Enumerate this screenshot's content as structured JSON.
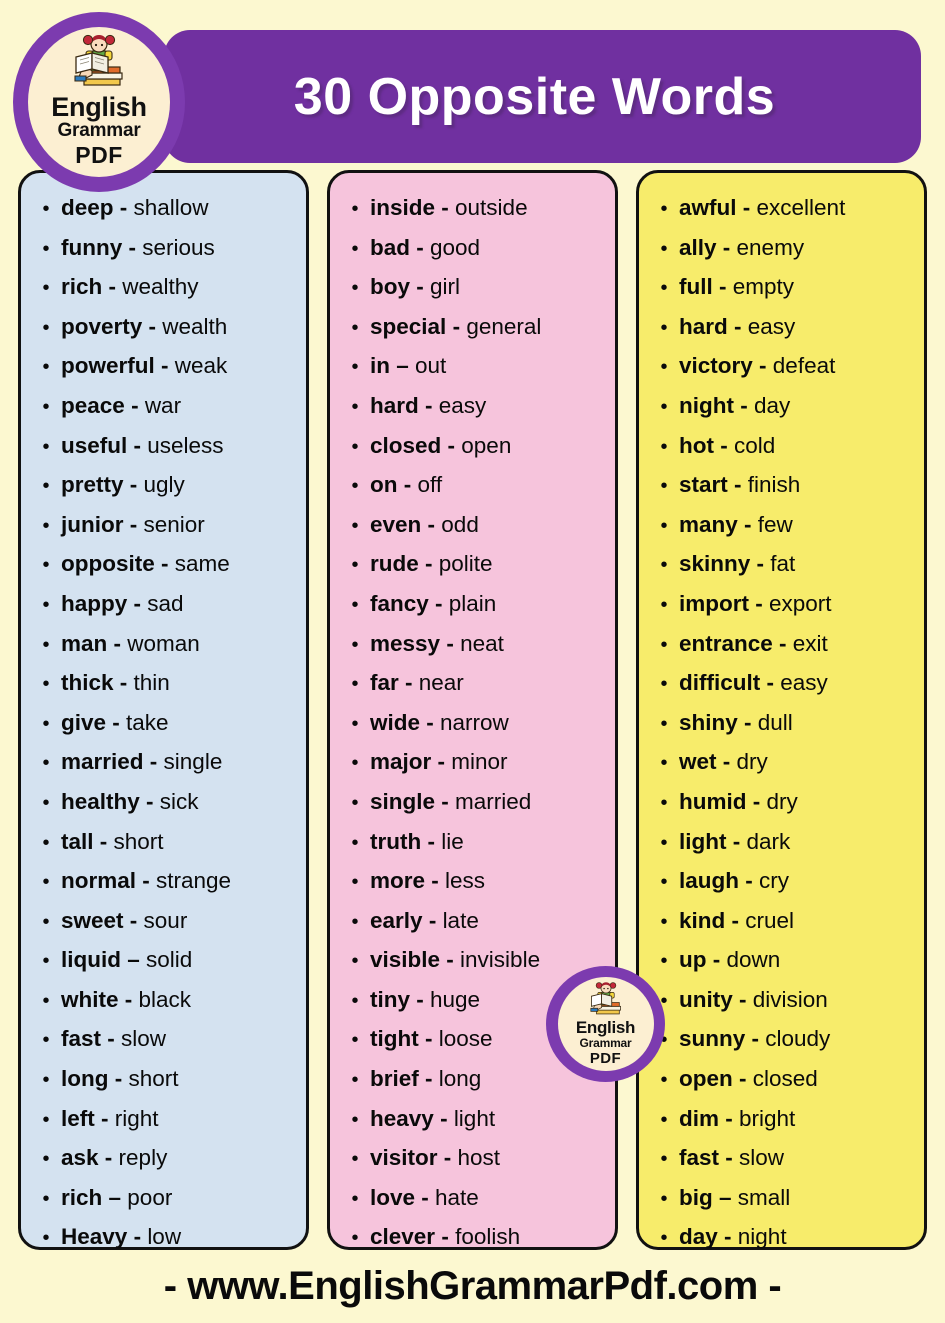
{
  "header": {
    "title": "30 Opposite Words",
    "bar_color": "#7030A0",
    "title_color": "#FFFFFF"
  },
  "logo": {
    "line1": "English",
    "line2": "Grammar",
    "line3": "PDF",
    "ring_color": "#7C3BAF",
    "face_color": "#FCEFD2",
    "icon": "girl-reading-book-on-books"
  },
  "page": {
    "background_color": "#FCF8D0"
  },
  "columns": [
    {
      "id": "column-1",
      "background_color": "#D4E2F0",
      "items": [
        {
          "word": "deep",
          "sep": "-",
          "opposite": "shallow"
        },
        {
          "word": "funny",
          "sep": "-",
          "opposite": "serious"
        },
        {
          "word": "rich",
          "sep": "-",
          "opposite": "wealthy"
        },
        {
          "word": "poverty",
          "sep": "-",
          "opposite": "wealth"
        },
        {
          "word": "powerful",
          "sep": "-",
          "opposite": "weak"
        },
        {
          "word": "peace",
          "sep": "-",
          "opposite": "war"
        },
        {
          "word": "useful",
          "sep": "-",
          "opposite": "useless"
        },
        {
          "word": "pretty",
          "sep": "-",
          "opposite": "ugly"
        },
        {
          "word": "junior",
          "sep": "-",
          "opposite": "senior"
        },
        {
          "word": "opposite",
          "sep": "-",
          "opposite": "same"
        },
        {
          "word": "happy",
          "sep": "-",
          "opposite": "sad"
        },
        {
          "word": "man",
          "sep": "-",
          "opposite": "woman"
        },
        {
          "word": "thick",
          "sep": "-",
          "opposite": "thin"
        },
        {
          "word": "give",
          "sep": "-",
          "opposite": "take"
        },
        {
          "word": "married",
          "sep": "-",
          "opposite": "single"
        },
        {
          "word": "healthy",
          "sep": "-",
          "opposite": "sick"
        },
        {
          "word": "tall",
          "sep": "-",
          "opposite": "short"
        },
        {
          "word": "normal",
          "sep": "-",
          "opposite": "strange"
        },
        {
          "word": "sweet",
          "sep": "-",
          "opposite": "sour"
        },
        {
          "word": "liquid",
          "sep": "–",
          "opposite": "solid"
        },
        {
          "word": "white",
          "sep": "-",
          "opposite": "black"
        },
        {
          "word": "fast",
          "sep": "-",
          "opposite": "slow"
        },
        {
          "word": "long",
          "sep": "-",
          "opposite": "short"
        },
        {
          "word": "left",
          "sep": "-",
          "opposite": "right"
        },
        {
          "word": "ask",
          "sep": "-",
          "opposite": "reply"
        },
        {
          "word": "rich",
          "sep": "–",
          "opposite": "poor"
        },
        {
          "word": "Heavy",
          "sep": "-",
          "opposite": "low"
        }
      ]
    },
    {
      "id": "column-2",
      "background_color": "#F6C4DC",
      "items": [
        {
          "word": "inside",
          "sep": "-",
          "opposite": "outside"
        },
        {
          "word": "bad",
          "sep": "-",
          "opposite": "good"
        },
        {
          "word": "boy",
          "sep": "-",
          "opposite": "girl"
        },
        {
          "word": "special",
          "sep": "-",
          "opposite": "general"
        },
        {
          "word": "in",
          "sep": "–",
          "opposite": "out"
        },
        {
          "word": "hard",
          "sep": "-",
          "opposite": "easy"
        },
        {
          "word": "closed",
          "sep": "-",
          "opposite": "open"
        },
        {
          "word": "on",
          "sep": "-",
          "opposite": "off"
        },
        {
          "word": "even",
          "sep": "-",
          "opposite": "odd"
        },
        {
          "word": "rude",
          "sep": "-",
          "opposite": "polite"
        },
        {
          "word": "fancy",
          "sep": "-",
          "opposite": "plain"
        },
        {
          "word": "messy",
          "sep": "-",
          "opposite": "neat"
        },
        {
          "word": "far",
          "sep": "-",
          "opposite": "near"
        },
        {
          "word": "wide",
          "sep": "-",
          "opposite": "narrow"
        },
        {
          "word": "major",
          "sep": "-",
          "opposite": "minor"
        },
        {
          "word": "single",
          "sep": "-",
          "opposite": "married"
        },
        {
          "word": "truth",
          "sep": "-",
          "opposite": "lie"
        },
        {
          "word": "more",
          "sep": "-",
          "opposite": "less"
        },
        {
          "word": "early",
          "sep": "-",
          "opposite": "late"
        },
        {
          "word": "visible",
          "sep": "-",
          "opposite": "invisible"
        },
        {
          "word": "tiny",
          "sep": "-",
          "opposite": "huge"
        },
        {
          "word": "tight",
          "sep": "-",
          "opposite": "loose"
        },
        {
          "word": "brief",
          "sep": "-",
          "opposite": "long"
        },
        {
          "word": "heavy",
          "sep": "-",
          "opposite": "light"
        },
        {
          "word": "visitor",
          "sep": "-",
          "opposite": "host"
        },
        {
          "word": "love",
          "sep": "-",
          "opposite": "hate"
        },
        {
          "word": "clever",
          "sep": "-",
          "opposite": "foolish"
        }
      ]
    },
    {
      "id": "column-3",
      "background_color": "#F7EC6B",
      "items": [
        {
          "word": "awful",
          "sep": "-",
          "opposite": "excellent"
        },
        {
          "word": "ally",
          "sep": "-",
          "opposite": "enemy"
        },
        {
          "word": "full",
          "sep": "-",
          "opposite": "empty"
        },
        {
          "word": "hard",
          "sep": "-",
          "opposite": "easy"
        },
        {
          "word": "victory",
          "sep": "-",
          "opposite": "defeat"
        },
        {
          "word": "night",
          "sep": "-",
          "opposite": "day"
        },
        {
          "word": "hot",
          "sep": "-",
          "opposite": "cold"
        },
        {
          "word": "start",
          "sep": "-",
          "opposite": "finish"
        },
        {
          "word": "many",
          "sep": "-",
          "opposite": "few"
        },
        {
          "word": "skinny",
          "sep": "-",
          "opposite": "fat"
        },
        {
          "word": "import",
          "sep": "-",
          "opposite": "export"
        },
        {
          "word": "entrance",
          "sep": "-",
          "opposite": "exit"
        },
        {
          "word": "difficult",
          "sep": "-",
          "opposite": "easy"
        },
        {
          "word": "shiny",
          "sep": "-",
          "opposite": "dull"
        },
        {
          "word": "wet",
          "sep": "-",
          "opposite": "dry"
        },
        {
          "word": "humid",
          "sep": "-",
          "opposite": "dry"
        },
        {
          "word": "light",
          "sep": "-",
          "opposite": "dark"
        },
        {
          "word": "laugh",
          "sep": "-",
          "opposite": "cry"
        },
        {
          "word": "kind",
          "sep": "-",
          "opposite": "cruel"
        },
        {
          "word": "up",
          "sep": "-",
          "opposite": "down"
        },
        {
          "word": "unity",
          "sep": "-",
          "opposite": "division"
        },
        {
          "word": "sunny",
          "sep": "-",
          "opposite": "cloudy"
        },
        {
          "word": "open",
          "sep": "-",
          "opposite": "closed"
        },
        {
          "word": "dim",
          "sep": "-",
          "opposite": "bright"
        },
        {
          "word": "fast",
          "sep": "-",
          "opposite": "slow"
        },
        {
          "word": "big",
          "sep": "–",
          "opposite": "small"
        },
        {
          "word": "day",
          "sep": "-",
          "opposite": "night"
        }
      ]
    }
  ],
  "footer": {
    "text": "-  www.EnglishGrammarPdf.com  -"
  },
  "bullet_glyph": "•"
}
